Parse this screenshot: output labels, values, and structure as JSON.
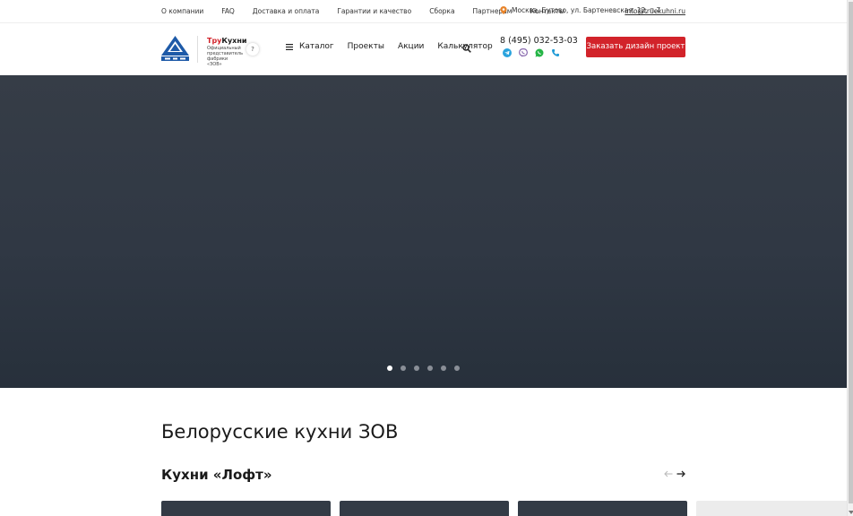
{
  "topbar": {
    "nav": [
      "О компании",
      "FAQ",
      "Доставка и оплата",
      "Гарантии и качество",
      "Сборка",
      "Партнерам",
      "Контакты"
    ],
    "address": "Москва, Бутово, ул. Бартеневская, 12, п.7",
    "email": "info@truekuhni.ru"
  },
  "header": {
    "brand_prefix": "Тру",
    "brand_suffix": "Кухни",
    "brand_sub": "Официальный представитель фабрики «ЗОВ»",
    "help_label": "?",
    "nav": {
      "catalog": "Каталог",
      "projects": "Проекты",
      "promos": "Акции",
      "calculator": "Калькулятор"
    },
    "phone": "8 (495) 032-53-03",
    "cta": "Заказать дизайн проект"
  },
  "hero": {
    "slides": 6,
    "active_slide": 1
  },
  "content": {
    "heading": "Белорусские кухни ЗОВ",
    "subheading": "Кухни «Лофт»"
  },
  "colors": {
    "accent": "#d2232a",
    "hero": "#303844"
  }
}
